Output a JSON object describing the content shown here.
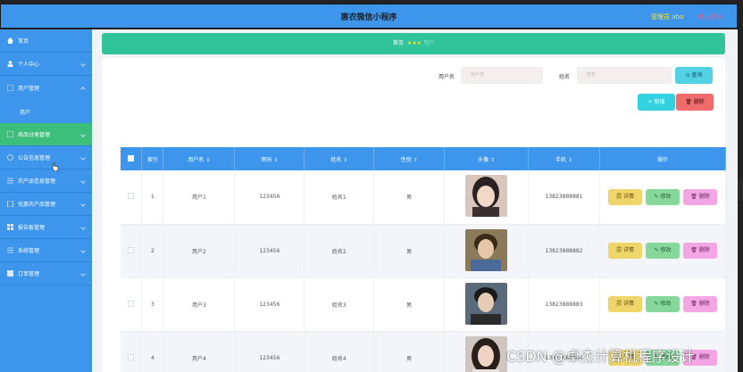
{
  "app": {
    "title": "惠农微信小程序",
    "admin": "管理员 abo",
    "logout": "退出登录"
  },
  "sidebar": {
    "items": [
      {
        "label": "首页",
        "icon": "home-icon"
      },
      {
        "label": "个人中心",
        "icon": "user-icon"
      },
      {
        "label": "用户管理",
        "icon": "list-icon"
      },
      {
        "label": "商品分类管理",
        "icon": "grid-icon"
      },
      {
        "label": "公告信息管理",
        "icon": "circle-icon"
      },
      {
        "label": "农产品信息管理",
        "icon": "list-icon"
      },
      {
        "label": "优惠农产品管理",
        "icon": "doc-icon"
      },
      {
        "label": "报告板管理",
        "icon": "grid-icon"
      },
      {
        "label": "系统管理",
        "icon": "list-icon"
      },
      {
        "label": "订单管理",
        "icon": "grid-icon"
      }
    ],
    "sub_item": "用户"
  },
  "breadcrumb": {
    "home": "首页",
    "stars": "★★★",
    "current": "用户"
  },
  "search": {
    "username_label": "用户名",
    "username_placeholder": "用户名",
    "name_label": "姓名",
    "name_placeholder": "姓名",
    "search_button": "⊙ 查询"
  },
  "actions": {
    "add": "+ 新增",
    "delete": "🗑 删除"
  },
  "table": {
    "headers": [
      "索引",
      "用户名",
      "密码",
      "姓名",
      "性别",
      "头像",
      "手机",
      "操作"
    ],
    "rows": [
      {
        "index": "1",
        "username": "用户1",
        "password": "123456",
        "name": "姓名1",
        "gender": "男",
        "phone": "13823888881"
      },
      {
        "index": "2",
        "username": "用户2",
        "password": "123456",
        "name": "姓名2",
        "gender": "男",
        "phone": "13823888882"
      },
      {
        "index": "3",
        "username": "用户3",
        "password": "123456",
        "name": "姓名3",
        "gender": "男",
        "phone": "13823888883"
      },
      {
        "index": "4",
        "username": "用户4",
        "password": "123456",
        "name": "姓名4",
        "gender": "男",
        "phone": "13823888884"
      }
    ],
    "row_actions": {
      "detail": "🗐 详情",
      "edit": "✎ 修改",
      "remove": "🗑 删除"
    }
  },
  "watermark": "CSDN @卓杰计算机程序设计",
  "colors": {
    "topbar": "#3d95ec",
    "active": "#3dbf7c",
    "breadcrumb": "#31c49a",
    "delete": "#f06b6b"
  }
}
